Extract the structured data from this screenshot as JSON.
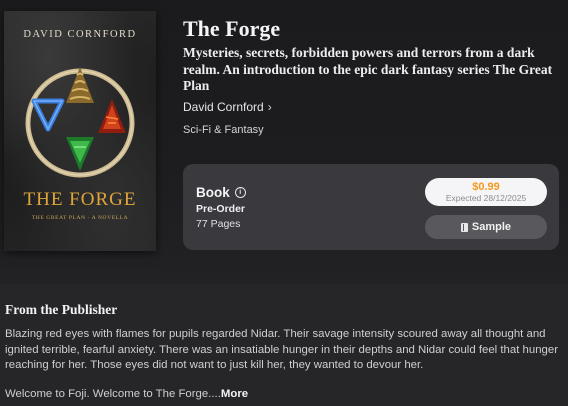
{
  "cover": {
    "author": "DAVID CORNFORD",
    "title": "THE FORGE",
    "subtitle": "THE GREAT PLAN - A NOVELLA"
  },
  "book": {
    "title": "The Forge",
    "subtitle": "Mysteries, secrets, forbidden powers and terrors from a dark realm. An introduction to the epic dark fantasy series The Great Plan",
    "author": "David Cornford",
    "genre": "Sci-Fi & Fantasy"
  },
  "purchase": {
    "format": "Book",
    "status": "Pre-Order",
    "pages": "77 Pages",
    "price": "$0.99",
    "expected": "Expected 28/12/2025",
    "sample_label": "Sample",
    "price_color": "#f39a1e"
  },
  "publisher": {
    "heading": "From the Publisher",
    "description": "Blazing red eyes with flames for pupils regarded Nidar. Their savage intensity scoured away all thought and ignited terrible, fearful anxiety. There was an insatiable hunger in their depths and Nidar could feel that hunger reaching for her. Those eyes did not want to just kill her, they wanted to devour her.",
    "teaser": "Welcome to Foji. Welcome to The Forge....",
    "more_label": "More"
  },
  "icons": {
    "author_chevron": "chevron-right-icon",
    "format_info": "info-icon",
    "sample": "book-icon"
  }
}
